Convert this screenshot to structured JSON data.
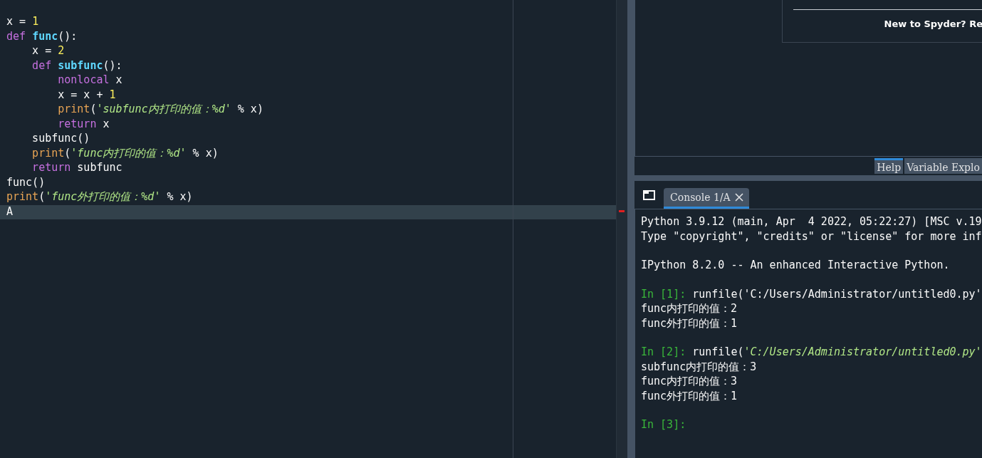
{
  "editor": {
    "lines": [
      {
        "current": false,
        "tokens": [
          {
            "kind": "plain",
            "text": "x = "
          },
          {
            "kind": "number",
            "text": "1"
          }
        ]
      },
      {
        "current": false,
        "tokens": [
          {
            "kind": "keyword",
            "text": "def "
          },
          {
            "kind": "defname",
            "text": "func"
          },
          {
            "kind": "plain",
            "text": "():"
          }
        ]
      },
      {
        "current": false,
        "tokens": [
          {
            "kind": "plain",
            "text": "    x = "
          },
          {
            "kind": "number",
            "text": "2"
          }
        ]
      },
      {
        "current": false,
        "tokens": [
          {
            "kind": "keyword",
            "text": "    def "
          },
          {
            "kind": "defname",
            "text": "subfunc"
          },
          {
            "kind": "plain",
            "text": "():"
          }
        ]
      },
      {
        "current": false,
        "tokens": [
          {
            "kind": "keyword",
            "text": "        nonlocal "
          },
          {
            "kind": "plain",
            "text": "x"
          }
        ]
      },
      {
        "current": false,
        "tokens": [
          {
            "kind": "plain",
            "text": "        x = x + "
          },
          {
            "kind": "number",
            "text": "1"
          }
        ]
      },
      {
        "current": false,
        "tokens": [
          {
            "kind": "builtin",
            "text": "        print"
          },
          {
            "kind": "plain",
            "text": "("
          },
          {
            "kind": "string",
            "text": "'subfunc内打印的值：%d'"
          },
          {
            "kind": "plain",
            "text": " % x)"
          }
        ]
      },
      {
        "current": false,
        "tokens": [
          {
            "kind": "keyword",
            "text": "        return "
          },
          {
            "kind": "plain",
            "text": "x"
          }
        ]
      },
      {
        "current": false,
        "tokens": [
          {
            "kind": "plain",
            "text": "    subfunc()"
          }
        ]
      },
      {
        "current": false,
        "tokens": [
          {
            "kind": "builtin",
            "text": "    print"
          },
          {
            "kind": "plain",
            "text": "("
          },
          {
            "kind": "string",
            "text": "'func内打印的值：%d'"
          },
          {
            "kind": "plain",
            "text": " % x)"
          }
        ]
      },
      {
        "current": false,
        "tokens": [
          {
            "kind": "keyword",
            "text": "    return "
          },
          {
            "kind": "plain",
            "text": "subfunc"
          }
        ]
      },
      {
        "current": false,
        "tokens": [
          {
            "kind": "plain",
            "text": "func()"
          }
        ]
      },
      {
        "current": false,
        "tokens": [
          {
            "kind": "builtin",
            "text": "print"
          },
          {
            "kind": "plain",
            "text": "("
          },
          {
            "kind": "string",
            "text": "'func外打印的值：%d'"
          },
          {
            "kind": "plain",
            "text": " % x)"
          }
        ]
      },
      {
        "current": true,
        "tokens": [
          {
            "kind": "plain",
            "text": "A"
          }
        ]
      }
    ]
  },
  "help_pane": {
    "notice": "New to Spyder? Re",
    "tabs": [
      {
        "label": "Help",
        "selected": true
      },
      {
        "label": "Variable Explo",
        "selected": false
      }
    ]
  },
  "console": {
    "tabs": [
      {
        "label": "Console 1/A",
        "selected": true
      }
    ],
    "blocks": [
      [
        [
          {
            "kind": "plain",
            "text": "Python 3.9.12 (main, Apr  4 2022, 05:22:27) [MSC v.19"
          }
        ],
        [
          {
            "kind": "plain",
            "text": "Type \"copyright\", \"credits\" or \"license\" for more inf"
          }
        ]
      ],
      [
        [
          {
            "kind": "plain",
            "text": "IPython 8.2.0 -- An enhanced Interactive Python."
          }
        ]
      ],
      [
        [
          {
            "kind": "prompt",
            "text": "In [1]:"
          },
          {
            "kind": "plain",
            "text": " runfile('C:/Users/Administrator/untitled0.py'"
          }
        ],
        [
          {
            "kind": "plain",
            "text": "func内打印的值：2"
          }
        ],
        [
          {
            "kind": "plain",
            "text": "func外打印的值：1"
          }
        ]
      ],
      [
        [
          {
            "kind": "prompt",
            "text": "In [2]:"
          },
          {
            "kind": "plain",
            "text": " runfile("
          },
          {
            "kind": "string",
            "text": "'C:/Users/Administrator/untitled0.py'"
          }
        ],
        [
          {
            "kind": "plain",
            "text": "subfunc内打印的值：3"
          }
        ],
        [
          {
            "kind": "plain",
            "text": "func内打印的值：3"
          }
        ],
        [
          {
            "kind": "plain",
            "text": "func外打印的值：1"
          }
        ]
      ],
      [
        [
          {
            "kind": "prompt",
            "text": "In [3]:"
          }
        ]
      ]
    ]
  }
}
